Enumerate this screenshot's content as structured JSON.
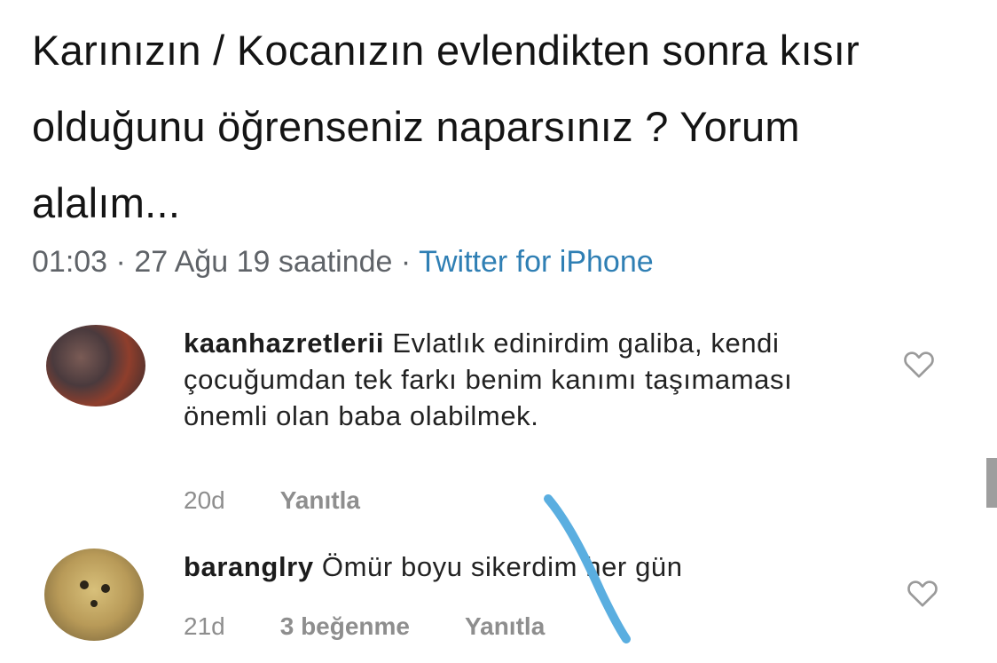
{
  "tweet": {
    "text": "Karınızın / Kocanızın evlendikten sonra kısır olduğunu öğrenseniz naparsınız ? Yorum alalım...",
    "time": "01:03",
    "sep1": " · ",
    "date": "27 Ağu 19 saatinde",
    "sep2": " · ",
    "source": "Twitter for iPhone"
  },
  "comments": [
    {
      "username": "kaanhazretlerii",
      "text": "Evlatlık edinirdim galiba, kendi çocuğumdan tek farkı benim kanımı taşımaması önemli olan baba olabilmek.",
      "age": "20d",
      "reply_label": "Yanıtla",
      "like_icon": "heart-outline-icon"
    },
    {
      "username": "baranglry",
      "text": "Ömür boyu sikerdim her gün",
      "age": "21d",
      "likes": "3 beğenme",
      "reply_label": "Yanıtla",
      "like_icon": "heart-outline-icon"
    }
  ],
  "colors": {
    "link": "#2f7fb4",
    "meta": "#5f6368",
    "footer": "#8e8e8e",
    "scribble": "#5aaee0"
  }
}
